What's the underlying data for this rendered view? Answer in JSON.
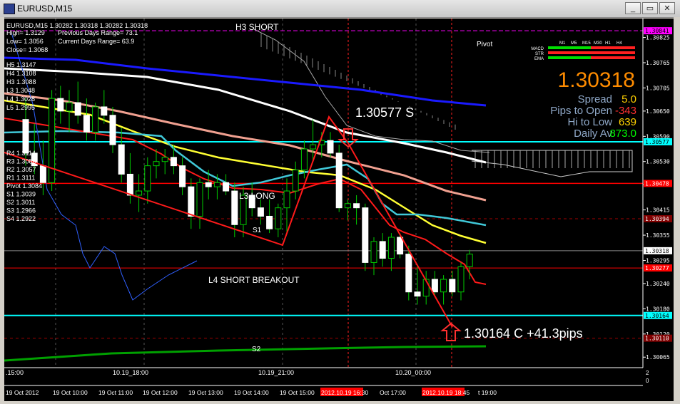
{
  "window": {
    "title": "EURUSD,M15",
    "minimize_label": "_",
    "restore_label": "▭",
    "close_label": "✕"
  },
  "info": {
    "header": "EURUSD,M15  1.30282 1.30318 1.30282 1.30318",
    "high": "High= 1.3129",
    "prev_range": "Previous Days Range= 73.1",
    "low": "Low= 1.3056",
    "curr_range": "Current Days Range= 63.9",
    "close": "Close= 1.3068"
  },
  "levels_list": [
    "H5 1.3147",
    "H4 1.3108",
    "H3 1.3088",
    "L3 1.3048",
    "L4 1.3028",
    "L5 1.2995"
  ],
  "pivots_list": [
    "R4 1.3114",
    "R3 1.3086",
    "R2 1.3057",
    "R1 1.3111",
    "Pivot 1.3084",
    "S1 1.3039",
    "S2 1.3011",
    "S3 1.2966",
    "S4 1.2922"
  ],
  "labels": {
    "h3_short": "H3 SHORT",
    "pivot": "Pivot",
    "l3_long": "L3 LONG",
    "s1": "S1",
    "l4_short": "L4 SHORT BREAKOUT",
    "s2": "S2",
    "sell_note": "1.30577 S",
    "close_note": "1.30164 C +41.3pips"
  },
  "stats": {
    "price": "1.30318",
    "spread_label": "Spread",
    "spread_value": "5.0",
    "pips_label": "Pips to Open",
    "pips_value": "-343",
    "hilo_label": "Hi to Low",
    "hilo_value": "639",
    "daily_label": "Daily Av",
    "daily_value": "873.0"
  },
  "mini_table": {
    "columns": [
      "M1",
      "M5",
      "M15",
      "M30",
      "H1",
      "H4"
    ],
    "rows": [
      "MACD",
      "STR",
      "EMA"
    ]
  },
  "price_axis": {
    "ticks": [
      "1.30825",
      "1.30765",
      "1.30705",
      "1.30650",
      "1.30590",
      "1.30530",
      "1.30475",
      "1.30415",
      "1.30355",
      "1.30295",
      "1.30240",
      "1.30180",
      "1.30120",
      "1.30065"
    ],
    "tags": [
      {
        "text": "1.30841",
        "bg": "#ff00ff",
        "fg": "#000000"
      },
      {
        "text": "1.30577",
        "bg": "#00ffff",
        "fg": "#000000"
      },
      {
        "text": "1.30478",
        "bg": "#ff0000",
        "fg": "#ffffff"
      },
      {
        "text": "1.30394",
        "bg": "#800000",
        "fg": "#ffffff"
      },
      {
        "text": "1.30318",
        "bg": "#ffffff",
        "fg": "#000000"
      },
      {
        "text": "1.30277",
        "bg": "#ff0000",
        "fg": "#ffffff"
      },
      {
        "text": "1.30164",
        "bg": "#00ffff",
        "fg": "#000000"
      },
      {
        "text": "1.30110",
        "bg": "#800000",
        "fg": "#ffffff"
      }
    ]
  },
  "inner_time_labels": [
    ".15:00",
    "10.19_18:00",
    "10.19_21:00",
    "10.20_00:00"
  ],
  "time_axis": [
    "19 Oct 2012",
    "19 Oct 10:00",
    "19 Oct 11:00",
    "19 Oct 12:00",
    "19 Oct 13:00",
    "19 Oct 14:00",
    "19 Oct 15:00",
    "2012.10.19 16:30",
    "Oct 17:00",
    "2012.10.19 18:45",
    "t 19:00"
  ],
  "subwindow_scale": [
    "2",
    "0"
  ],
  "colors": {
    "bg": "#000000",
    "grid": "#4a4a4a",
    "bull": "#00cc00",
    "bear": "#ffffff",
    "accent": "#ff8c00"
  },
  "chart_data": {
    "type": "candlestick",
    "symbol": "EURUSD",
    "timeframe": "M15",
    "ylim": [
      1.3004,
      1.3087
    ],
    "ohlc": [
      [
        1.3063,
        1.3068,
        1.3052,
        1.3055
      ],
      [
        1.3055,
        1.3062,
        1.305,
        1.3052
      ],
      [
        1.3052,
        1.3058,
        1.3045,
        1.3048
      ],
      [
        1.3048,
        1.307,
        1.3046,
        1.3068
      ],
      [
        1.3068,
        1.3071,
        1.3062,
        1.3065
      ],
      [
        1.3065,
        1.307,
        1.306,
        1.3067
      ],
      [
        1.3067,
        1.3072,
        1.3062,
        1.3064
      ],
      [
        1.3064,
        1.3068,
        1.3058,
        1.306
      ],
      [
        1.306,
        1.3067,
        1.3058,
        1.3066
      ],
      [
        1.3066,
        1.307,
        1.3062,
        1.3064
      ],
      [
        1.3064,
        1.3066,
        1.3055,
        1.3057
      ],
      [
        1.3057,
        1.3061,
        1.3048,
        1.305
      ],
      [
        1.305,
        1.3055,
        1.3043,
        1.3045
      ],
      [
        1.3045,
        1.305,
        1.3041,
        1.3046
      ],
      [
        1.3046,
        1.3054,
        1.3043,
        1.3052
      ],
      [
        1.3052,
        1.3056,
        1.3049,
        1.3053
      ],
      [
        1.3053,
        1.3056,
        1.305,
        1.3054
      ],
      [
        1.3054,
        1.3057,
        1.305,
        1.3052
      ],
      [
        1.3052,
        1.3054,
        1.3045,
        1.3047
      ],
      [
        1.3047,
        1.3049,
        1.3037,
        1.304
      ],
      [
        1.304,
        1.3049,
        1.3037,
        1.3048
      ],
      [
        1.3048,
        1.3051,
        1.3044,
        1.3047
      ],
      [
        1.3047,
        1.305,
        1.3044,
        1.3048
      ],
      [
        1.3048,
        1.305,
        1.3045,
        1.3046
      ],
      [
        1.3046,
        1.3048,
        1.3035,
        1.3038
      ],
      [
        1.3038,
        1.3047,
        1.3035,
        1.3045
      ],
      [
        1.3045,
        1.3048,
        1.304,
        1.3042
      ],
      [
        1.3042,
        1.3044,
        1.3038,
        1.304
      ],
      [
        1.304,
        1.3044,
        1.3036,
        1.3037
      ],
      [
        1.3037,
        1.3043,
        1.3035,
        1.3042
      ],
      [
        1.3042,
        1.3049,
        1.3036,
        1.3046
      ],
      [
        1.3046,
        1.3053,
        1.3044,
        1.3051
      ],
      [
        1.3051,
        1.3058,
        1.3049,
        1.3056
      ],
      [
        1.3056,
        1.3063,
        1.3053,
        1.3057
      ],
      [
        1.3057,
        1.306,
        1.3054,
        1.3058
      ],
      [
        1.3058,
        1.306,
        1.3054,
        1.3055
      ],
      [
        1.3055,
        1.3057,
        1.3041,
        1.3042
      ],
      [
        1.3042,
        1.3044,
        1.3039,
        1.3043
      ],
      [
        1.3043,
        1.3045,
        1.3038,
        1.3042
      ],
      [
        1.3042,
        1.3043,
        1.3027,
        1.3029
      ],
      [
        1.3029,
        1.3035,
        1.3026,
        1.3034
      ],
      [
        1.3034,
        1.3036,
        1.3028,
        1.303
      ],
      [
        1.303,
        1.3036,
        1.3027,
        1.3035
      ],
      [
        1.3035,
        1.3036,
        1.303,
        1.3031
      ],
      [
        1.3031,
        1.3033,
        1.302,
        1.3022
      ],
      [
        1.3022,
        1.3028,
        1.3019,
        1.3021
      ],
      [
        1.3021,
        1.3027,
        1.3019,
        1.3025
      ],
      [
        1.3025,
        1.3027,
        1.3021,
        1.3022
      ],
      [
        1.3022,
        1.3026,
        1.3019,
        1.3025
      ],
      [
        1.3025,
        1.3027,
        1.3021,
        1.3022
      ],
      [
        1.3022,
        1.3029,
        1.302,
        1.3028
      ],
      [
        1.3028,
        1.3032,
        1.3025,
        1.3031
      ]
    ],
    "price_markers": [
      1.30841,
      1.30577,
      1.30478,
      1.30394,
      1.30318,
      1.30277,
      1.30164,
      1.3011
    ]
  }
}
